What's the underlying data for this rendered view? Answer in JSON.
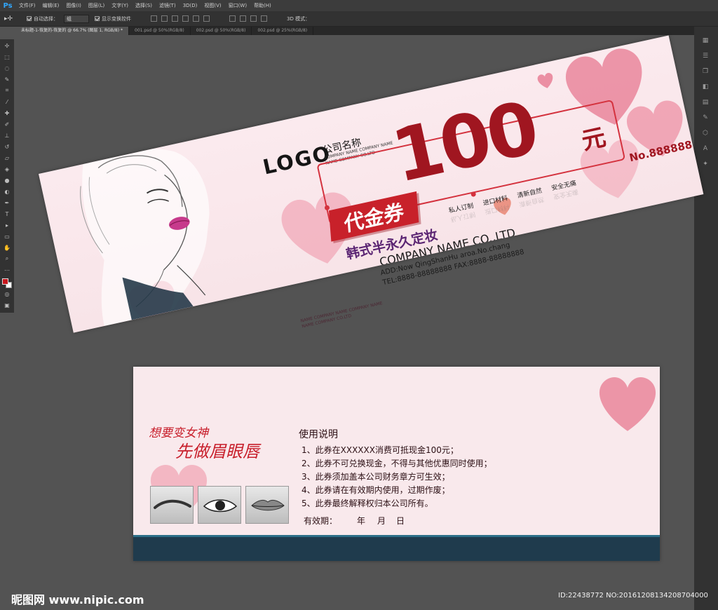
{
  "app": {
    "menus": [
      "文件(F)",
      "编辑(E)",
      "图像(I)",
      "图层(L)",
      "文字(Y)",
      "选择(S)",
      "滤镜(T)",
      "3D(D)",
      "视图(V)",
      "窗口(W)",
      "帮助(H)"
    ],
    "options": {
      "auto_select_label": "自动选择：",
      "auto_select_value": "组",
      "show_transform_label": "显示变换控件",
      "mode_3d_label": "3D 模式："
    },
    "tabs": [
      "未标题-1-恢复的-恢复的 @ 66.7% (图层 1, RGB/8) *",
      "001.psd @ 50%(RGB/8)",
      "002.psd @ 50%(RGB/8)",
      "002.psd @ 25%(RGB/8)"
    ],
    "colors": {
      "foreground": "#c8181e",
      "background": "#ffffff"
    }
  },
  "front": {
    "logo_word": "LOGO",
    "company_cn": "公司名称",
    "logo_sub1": "COMPANY NAME COMPANY NAME",
    "logo_sub2": "NAME COMPANY CO.LTD",
    "amount": "100",
    "unit": "元",
    "badge": "代金券",
    "promo": "韩式半永久定妆",
    "features": [
      "私人订制",
      "进口材料",
      "清新自然",
      "安全无痛"
    ],
    "serial": "No.88888888",
    "company_en": "COMPANY NAME CO.,LTD",
    "address": "ADD:Now QingShanHu aroa.No.chang",
    "tel": "TEL:8888-88888888  FAX:8888-88888888",
    "reflect1": "NAME COMPANY NAME COMPANY NAME",
    "reflect2": "NAME COMPANY CO.LTD"
  },
  "back": {
    "slogan1": "想要变女神",
    "slogan2": "先做眉眼唇",
    "thumbs": [
      "eyebrow-thumb",
      "eye-thumb",
      "lips-thumb"
    ],
    "usage_title": "使用说明",
    "rules": [
      "1、此券在XXXXXX消费可抵现金100元；",
      "2、此券不可兑换现金，不得与其他优惠同时使用；",
      "3、此券须加盖本公司财务章方可生效；",
      "4、此券请在有效期内使用，过期作废；",
      "5、此券最终解释权归本公司所有。"
    ],
    "validity_label": "有效期：",
    "validity_year": "年",
    "validity_month": "月",
    "validity_day": "日"
  },
  "watermark": {
    "left": "昵图网 www.nipic.com",
    "right": "ID:22438772 NO:20161208134208704000"
  }
}
